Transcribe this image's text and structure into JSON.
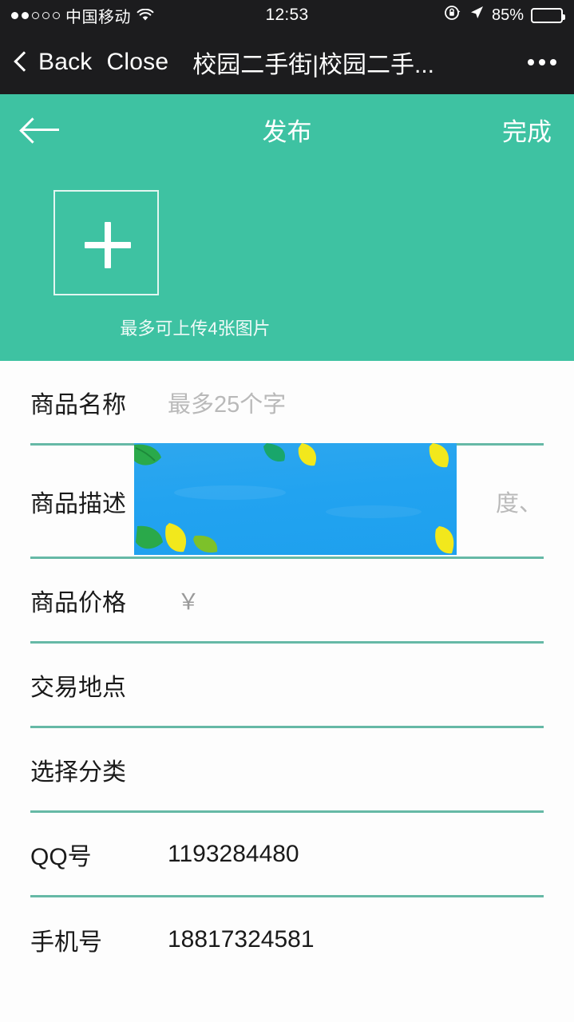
{
  "status_bar": {
    "signal_filled": 2,
    "signal_empty": 3,
    "carrier": "中国移动",
    "wifi_icon": "wifi-icon",
    "time": "12:53",
    "rotation_lock_icon": "rotation-lock-icon",
    "location_icon": "location-arrow-icon",
    "battery_percent": "85%",
    "battery_level": 85
  },
  "webview_bar": {
    "back_chevron_icon": "chevron-left-icon",
    "back_label": "Back",
    "close_label": "Close",
    "page_title": "校园二手街|校园二手...",
    "more_icon": "more-dots-icon"
  },
  "app_bar": {
    "back_arrow_icon": "arrow-left-icon",
    "title": "发布",
    "action_label": "完成",
    "background_color": "#3ec2a2"
  },
  "uploader": {
    "add_icon": "plus-icon",
    "hint": "最多可上传4张图片",
    "max_images": 4
  },
  "form": {
    "rows": [
      {
        "label": "商品名称",
        "placeholder": "最多25个字",
        "value": ""
      },
      {
        "label": "商品描述",
        "placeholder": "度、",
        "value": ""
      },
      {
        "label": "商品价格",
        "placeholder": "￥",
        "value": ""
      },
      {
        "label": "交易地点",
        "placeholder": "",
        "value": ""
      },
      {
        "label": "选择分类",
        "placeholder": "",
        "value": ""
      },
      {
        "label": "QQ号",
        "placeholder": "",
        "value": "1193284480"
      },
      {
        "label": "手机号",
        "placeholder": "",
        "value": "18817324581"
      }
    ],
    "divider_color": "#66b9a6"
  },
  "overlay_banner": {
    "name": "blue-leaf-banner",
    "background_color": "#22a3f0",
    "leaf_colors": [
      "#2aa94a",
      "#f2e81c",
      "#19a66b",
      "#7dc12a"
    ]
  }
}
